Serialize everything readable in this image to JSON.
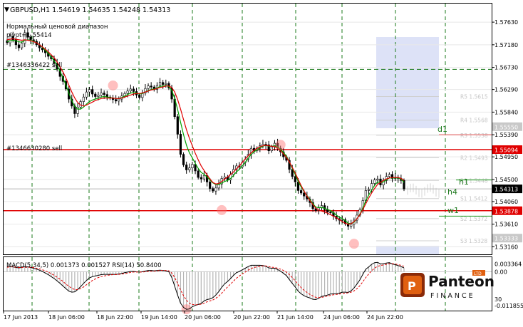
{
  "chart_data": [
    {
      "type": "candlestick",
      "title": "GBPUSD,H1  1.54619 1.54635 1.54248 1.54313",
      "indicator_label": "Нормальный ценовой диапазон",
      "pivot_label": "pivot=1.55414",
      "y_ticks": [
        "1.57630",
        "1.57180",
        "1.56730",
        "1.56290",
        "1.55840",
        "1.55390",
        "1.54950",
        "1.54500",
        "1.54060",
        "1.53610",
        "1.53160"
      ],
      "y_range": [
        1.5301,
        1.58
      ],
      "price_flags": [
        {
          "label": "1.55094",
          "value": 1.55094,
          "color": "#e00000"
        },
        {
          "label": "1.54313",
          "value": 1.54313,
          "color": "#000000"
        },
        {
          "label": "1.53878",
          "value": 1.53878,
          "color": "#e00000"
        },
        {
          "label": "1.53333",
          "value": 1.53333,
          "color": "#c8c8c8"
        },
        {
          "label": "1.55550",
          "value": 1.5555,
          "color": "#c8c8c8"
        }
      ],
      "order_lines": [
        {
          "label": "#1346336422 sell",
          "value": 1.5669
        },
        {
          "label": "#1346630280 sell",
          "value": 1.5516
        }
      ],
      "pivot_levels_faded": [
        "R5 1.5615",
        "R4 1.5568",
        "R3 1.5538",
        "R2 1.5493",
        "R1 1.5448",
        "S1 1.5412",
        "S2 1.5372",
        "S3 1.5328"
      ],
      "pivot_labels": [
        "d1",
        "h1",
        "h4",
        "w1"
      ],
      "close": [
        1.5722,
        1.5735,
        1.5728,
        1.5718,
        1.5712,
        1.5721,
        1.5742,
        1.5733,
        1.5728,
        1.5725,
        1.5718,
        1.5712,
        1.5708,
        1.5702,
        1.5695,
        1.569,
        1.5681,
        1.567,
        1.5655,
        1.5645,
        1.563,
        1.561,
        1.5596,
        1.5581,
        1.5594,
        1.5605,
        1.5614,
        1.5624,
        1.5629,
        1.562,
        1.5615,
        1.5618,
        1.5622,
        1.5619,
        1.5614,
        1.5612,
        1.5609,
        1.5606,
        1.561,
        1.5616,
        1.5621,
        1.5626,
        1.563,
        1.5625,
        1.5618,
        1.5613,
        1.5622,
        1.5631,
        1.5636,
        1.5634,
        1.5629,
        1.5637,
        1.5643,
        1.5639,
        1.5641,
        1.5632,
        1.561,
        1.5575,
        1.554,
        1.55,
        1.5479,
        1.5469,
        1.5473,
        1.548,
        1.5467,
        1.5454,
        1.5451,
        1.5458,
        1.5445,
        1.5432,
        1.5427,
        1.5433,
        1.5441,
        1.5452,
        1.5455,
        1.5449,
        1.546,
        1.547,
        1.5477,
        1.5475,
        1.5484,
        1.549,
        1.55,
        1.5512,
        1.5507,
        1.5512,
        1.5517,
        1.552,
        1.5519,
        1.5507,
        1.5515,
        1.5522,
        1.5512,
        1.5505,
        1.5495,
        1.5488,
        1.547,
        1.5456,
        1.5445,
        1.5428,
        1.5423,
        1.5417,
        1.5411,
        1.5404,
        1.5392,
        1.5388,
        1.5394,
        1.5398,
        1.539,
        1.5385,
        1.5384,
        1.5377,
        1.5372,
        1.5369,
        1.537,
        1.5362,
        1.5357,
        1.5361,
        1.5369,
        1.5379,
        1.539,
        1.5408,
        1.5428,
        1.543,
        1.5442,
        1.5449,
        1.5451,
        1.5439,
        1.5448,
        1.5456,
        1.546,
        1.5452,
        1.5454,
        1.5452,
        1.5448,
        1.5431
      ],
      "ma_red": [
        1.5728,
        1.5729,
        1.573,
        1.5729,
        1.5728,
        1.5727,
        1.5728,
        1.5727,
        1.5726,
        1.5724,
        1.5722,
        1.5718,
        1.5714,
        1.5709,
        1.5704,
        1.5698,
        1.5692,
        1.5684,
        1.5674,
        1.5664,
        1.5652,
        1.5638,
        1.5624,
        1.5612,
        1.5603,
        1.5598,
        1.5596,
        1.5598,
        1.5601,
        1.5604,
        1.5607,
        1.5609,
        1.5611,
        1.5612,
        1.5612,
        1.5612,
        1.5612,
        1.5611,
        1.5611,
        1.5612,
        1.5614,
        1.5616,
        1.5618,
        1.562,
        1.5621,
        1.5621,
        1.5622,
        1.5624,
        1.5626,
        1.5628,
        1.5629,
        1.5631,
        1.5633,
        1.5634,
        1.5636,
        1.5636,
        1.5633,
        1.5624,
        1.5609,
        1.559,
        1.5569,
        1.5549,
        1.5532,
        1.5517,
        1.5502,
        1.5489,
        1.5477,
        1.5468,
        1.5459,
        1.5451,
        1.5444,
        1.5441,
        1.5442,
        1.5446,
        1.5451,
        1.5455,
        1.546,
        1.5465,
        1.5471,
        1.5477,
        1.5484,
        1.5491,
        1.5497,
        1.5503,
        1.5508,
        1.5512,
        1.5515,
        1.5517,
        1.5518,
        1.5517,
        1.5516,
        1.5515,
        1.5512,
        1.5507,
        1.5501,
        1.5494,
        1.5485,
        1.5474,
        1.5463,
        1.545,
        1.5438,
        1.5427,
        1.5417,
        1.5408,
        1.54,
        1.5393,
        1.5389,
        1.5387,
        1.5385,
        1.5383,
        1.538,
        1.5377,
        1.5374,
        1.537,
        1.5366,
        1.5363,
        1.5361,
        1.5362,
        1.5366,
        1.5372,
        1.538,
        1.539,
        1.5402,
        1.5413,
        1.5423,
        1.5432,
        1.544,
        1.5444,
        1.5448,
        1.5451,
        1.5453,
        1.5454,
        1.5454,
        1.5454,
        1.5452,
        1.5448
      ],
      "ma_green": [
        1.5724,
        1.5726,
        1.5727,
        1.5726,
        1.5724,
        1.5723,
        1.5727,
        1.5728,
        1.5727,
        1.5725,
        1.5722,
        1.5718,
        1.5713,
        1.5707,
        1.5701,
        1.5694,
        1.5686,
        1.5677,
        1.5665,
        1.5652,
        1.5638,
        1.5622,
        1.5607,
        1.5595,
        1.559,
        1.559,
        1.5594,
        1.56,
        1.5605,
        1.5608,
        1.561,
        1.5612,
        1.5614,
        1.5615,
        1.5614,
        1.5613,
        1.5612,
        1.5611,
        1.5611,
        1.5613,
        1.5616,
        1.5619,
        1.5622,
        1.5623,
        1.5622,
        1.562,
        1.5621,
        1.5624,
        1.5627,
        1.5629,
        1.563,
        1.5632,
        1.5635,
        1.5636,
        1.5637,
        1.5635,
        1.5627,
        1.5611,
        1.5589,
        1.5564,
        1.5539,
        1.5518,
        1.5503,
        1.5493,
        1.5482,
        1.5472,
        1.5464,
        1.546,
        1.5455,
        1.5449,
        1.5443,
        1.544,
        1.544,
        1.5443,
        1.5446,
        1.5448,
        1.5452,
        1.5458,
        1.5465,
        1.547,
        1.5477,
        1.5484,
        1.5492,
        1.55,
        1.5505,
        1.5509,
        1.5513,
        1.5516,
        1.5518,
        1.5516,
        1.5516,
        1.5517,
        1.5515,
        1.551,
        1.5504,
        1.5496,
        1.5485,
        1.5472,
        1.546,
        1.5446,
        1.5435,
        1.5426,
        1.5418,
        1.541,
        1.5402,
        1.5395,
        1.5394,
        1.5394,
        1.5393,
        1.539,
        1.5388,
        1.5384,
        1.5379,
        1.5375,
        1.5372,
        1.5368,
        1.5363,
        1.5362,
        1.5365,
        1.5372,
        1.5381,
        1.5393,
        1.5408,
        1.5419,
        1.5429,
        1.5438,
        1.5445,
        1.5444,
        1.5445,
        1.5449,
        1.5453,
        1.5453,
        1.5453,
        1.5453,
        1.5451,
        1.5444
      ],
      "x_labels": [
        "17 Jun 2013",
        "18 Jun 06:00",
        "18 Jun 22:00",
        "19 Jun 14:00",
        "20 Jun 06:00",
        "20 Jun 22:00",
        "21 Jun 14:00",
        "24 Jun 06:00",
        "24 Jun 22:00"
      ]
    },
    {
      "type": "line",
      "title": "MACD(5,34,5) 0.001373 0.001527  RSI(14) 50.8400",
      "y_ticks": [
        "0.003364",
        "0.00",
        "30",
        "-0.011855"
      ],
      "series": [
        {
          "name": "MACD",
          "color": "#000000"
        },
        {
          "name": "Signal",
          "color": "#e00000"
        }
      ],
      "macd": [
        0.0015,
        0.0016,
        0.0015,
        0.0013,
        0.0012,
        0.0013,
        0.0016,
        0.0015,
        0.0013,
        0.0011,
        0.0008,
        0.0005,
        0.0001,
        -0.0004,
        -0.0009,
        -0.0015,
        -0.0021,
        -0.0028,
        -0.0036,
        -0.0044,
        -0.0052,
        -0.006,
        -0.0063,
        -0.0062,
        -0.0055,
        -0.0046,
        -0.0036,
        -0.0027,
        -0.0019,
        -0.0015,
        -0.0013,
        -0.0011,
        -0.0009,
        -0.0008,
        -0.0008,
        -0.0008,
        -0.0008,
        -0.0008,
        -0.0007,
        -0.0005,
        -0.0003,
        -0.0001,
        0.0001,
        0.0001,
        0.0,
        -0.0001,
        0.0,
        0.0002,
        0.0004,
        0.0004,
        0.0003,
        0.0004,
        0.0005,
        0.0004,
        0.0003,
        0.0,
        -0.0018,
        -0.0045,
        -0.0072,
        -0.0097,
        -0.011,
        -0.0116,
        -0.0115,
        -0.0108,
        -0.0104,
        -0.0101,
        -0.0098,
        -0.009,
        -0.0086,
        -0.0084,
        -0.008,
        -0.0072,
        -0.0061,
        -0.0048,
        -0.0037,
        -0.003,
        -0.0021,
        -0.0011,
        -0.0003,
        0.0001,
        0.0006,
        0.0011,
        0.0016,
        0.002,
        0.002,
        0.002,
        0.002,
        0.0019,
        0.0017,
        0.0012,
        0.0011,
        0.0011,
        0.0007,
        0.0002,
        -0.0005,
        -0.0012,
        -0.0024,
        -0.0036,
        -0.0047,
        -0.006,
        -0.0068,
        -0.0074,
        -0.0078,
        -0.0081,
        -0.0085,
        -0.0086,
        -0.0082,
        -0.0076,
        -0.0074,
        -0.0072,
        -0.0069,
        -0.0068,
        -0.0068,
        -0.0066,
        -0.0063,
        -0.0063,
        -0.0064,
        -0.0059,
        -0.005,
        -0.0038,
        -0.0025,
        -0.0008,
        0.0008,
        0.0015,
        0.0023,
        0.0028,
        0.0029,
        0.0024,
        0.0025,
        0.0027,
        0.0028,
        0.0024,
        0.0022,
        0.0019,
        0.0016,
        0.0012
      ],
      "signal": [
        0.0014,
        0.0015,
        0.0015,
        0.0014,
        0.0013,
        0.0013,
        0.0014,
        0.0014,
        0.0014,
        0.0013,
        0.0011,
        0.0009,
        0.0006,
        0.0003,
        -0.0001,
        -0.0006,
        -0.0011,
        -0.0017,
        -0.0023,
        -0.003,
        -0.0038,
        -0.0045,
        -0.0051,
        -0.0055,
        -0.0055,
        -0.0052,
        -0.0047,
        -0.004,
        -0.0033,
        -0.0027,
        -0.0022,
        -0.0018,
        -0.0015,
        -0.0013,
        -0.0011,
        -0.001,
        -0.0009,
        -0.0009,
        -0.0008,
        -0.0007,
        -0.0006,
        -0.0004,
        -0.0002,
        -0.0001,
        -0.0001,
        -0.0001,
        -0.0001,
        0.0,
        0.0001,
        0.0002,
        0.0002,
        0.0003,
        0.0004,
        0.0004,
        0.0004,
        0.0003,
        -0.0004,
        -0.0018,
        -0.0036,
        -0.0056,
        -0.0074,
        -0.0088,
        -0.0097,
        -0.0101,
        -0.0102,
        -0.0102,
        -0.01,
        -0.0097,
        -0.0093,
        -0.009,
        -0.0087,
        -0.0082,
        -0.0075,
        -0.0066,
        -0.0056,
        -0.0047,
        -0.0038,
        -0.0029,
        -0.002,
        -0.0013,
        -0.0007,
        -0.0001,
        0.0005,
        0.001,
        0.0013,
        0.0015,
        0.0017,
        0.0018,
        0.0018,
        0.0016,
        0.0014,
        0.0013,
        0.0011,
        0.0008,
        0.0004,
        -0.0001,
        -0.0009,
        -0.0018,
        -0.0028,
        -0.0039,
        -0.0049,
        -0.0057,
        -0.0064,
        -0.007,
        -0.0075,
        -0.0079,
        -0.008,
        -0.0079,
        -0.0077,
        -0.0075,
        -0.0073,
        -0.0071,
        -0.007,
        -0.0069,
        -0.0067,
        -0.0066,
        -0.0065,
        -0.0063,
        -0.0059,
        -0.0052,
        -0.0043,
        -0.0031,
        -0.0018,
        -0.0007,
        0.0003,
        0.0011,
        0.0017,
        0.0019,
        0.0021,
        0.0023,
        0.0025,
        0.0025,
        0.0024,
        0.0022,
        0.002,
        0.0017
      ]
    }
  ],
  "logo": {
    "name": "Panteon",
    "sub": "FINANCE",
    "badge": "LTD"
  }
}
